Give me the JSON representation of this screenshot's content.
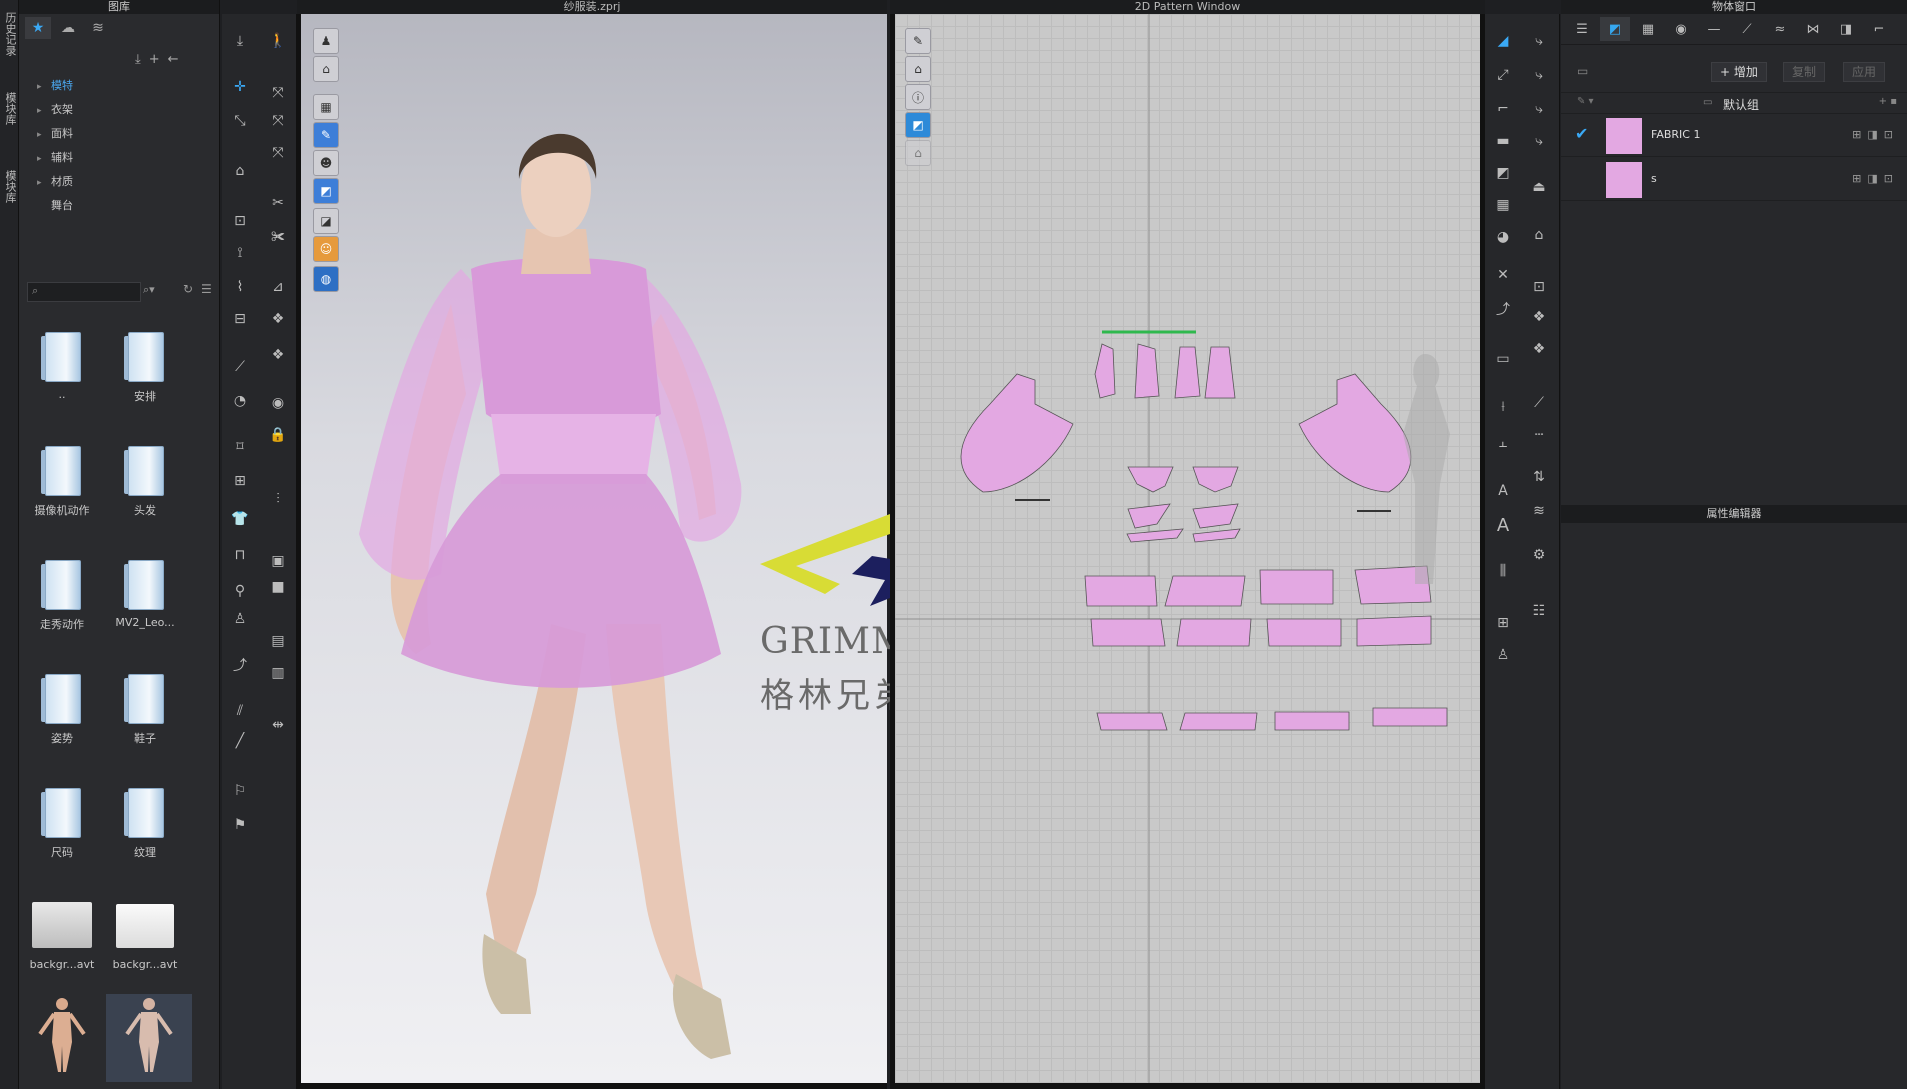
{
  "left_tabs": [
    "历史记录",
    "模块库",
    "模块库"
  ],
  "library": {
    "title": "图库",
    "tabs": [
      {
        "icon": "star-icon"
      },
      {
        "icon": "cloud-icon"
      },
      {
        "icon": "clo-icon"
      }
    ],
    "tree": [
      {
        "label": "模特",
        "selected": true
      },
      {
        "label": "衣架"
      },
      {
        "label": "面料"
      },
      {
        "label": "辅料"
      },
      {
        "label": "材质"
      },
      {
        "label": "舞台"
      }
    ],
    "items": [
      {
        "label": "..",
        "type": "folder"
      },
      {
        "label": "安排",
        "type": "folder"
      },
      {
        "label": "摄像机动作",
        "type": "folder"
      },
      {
        "label": "头发",
        "type": "folder"
      },
      {
        "label": "走秀动作",
        "type": "folder"
      },
      {
        "label": "MV2_Leo...",
        "type": "folder"
      },
      {
        "label": "姿势",
        "type": "folder"
      },
      {
        "label": "鞋子",
        "type": "folder"
      },
      {
        "label": "尺码",
        "type": "folder"
      },
      {
        "label": "纹理",
        "type": "folder"
      },
      {
        "label": "backgr...avt",
        "type": "file"
      },
      {
        "label": "backgr...avt",
        "type": "file"
      },
      {
        "label": "",
        "type": "avatar"
      },
      {
        "label": "",
        "type": "avatar-selected"
      }
    ]
  },
  "window3d": {
    "title": "纱服装.zprj"
  },
  "window2d": {
    "title": "2D Pattern Window"
  },
  "watermark": {
    "line1": "GRIMM BRO",
    "line2": "格林兄弟科技"
  },
  "object_window": {
    "title": "物体窗口",
    "add_label": "+ 增加",
    "copy_label": "复制",
    "apply_label": "应用",
    "group_label": "默认组",
    "fabrics": [
      {
        "name": "FABRIC 1",
        "checked": true,
        "color": "#e3a8e2"
      },
      {
        "name": "s",
        "checked": false,
        "color": "#e3a8e2"
      }
    ]
  },
  "property_editor": {
    "title": "属性编辑器"
  },
  "colors": {
    "fabric": "#e3a8e2",
    "accent": "#36a8f0",
    "watermark_yellow": "#d8dc35",
    "watermark_navy": "#1c1f5e"
  }
}
